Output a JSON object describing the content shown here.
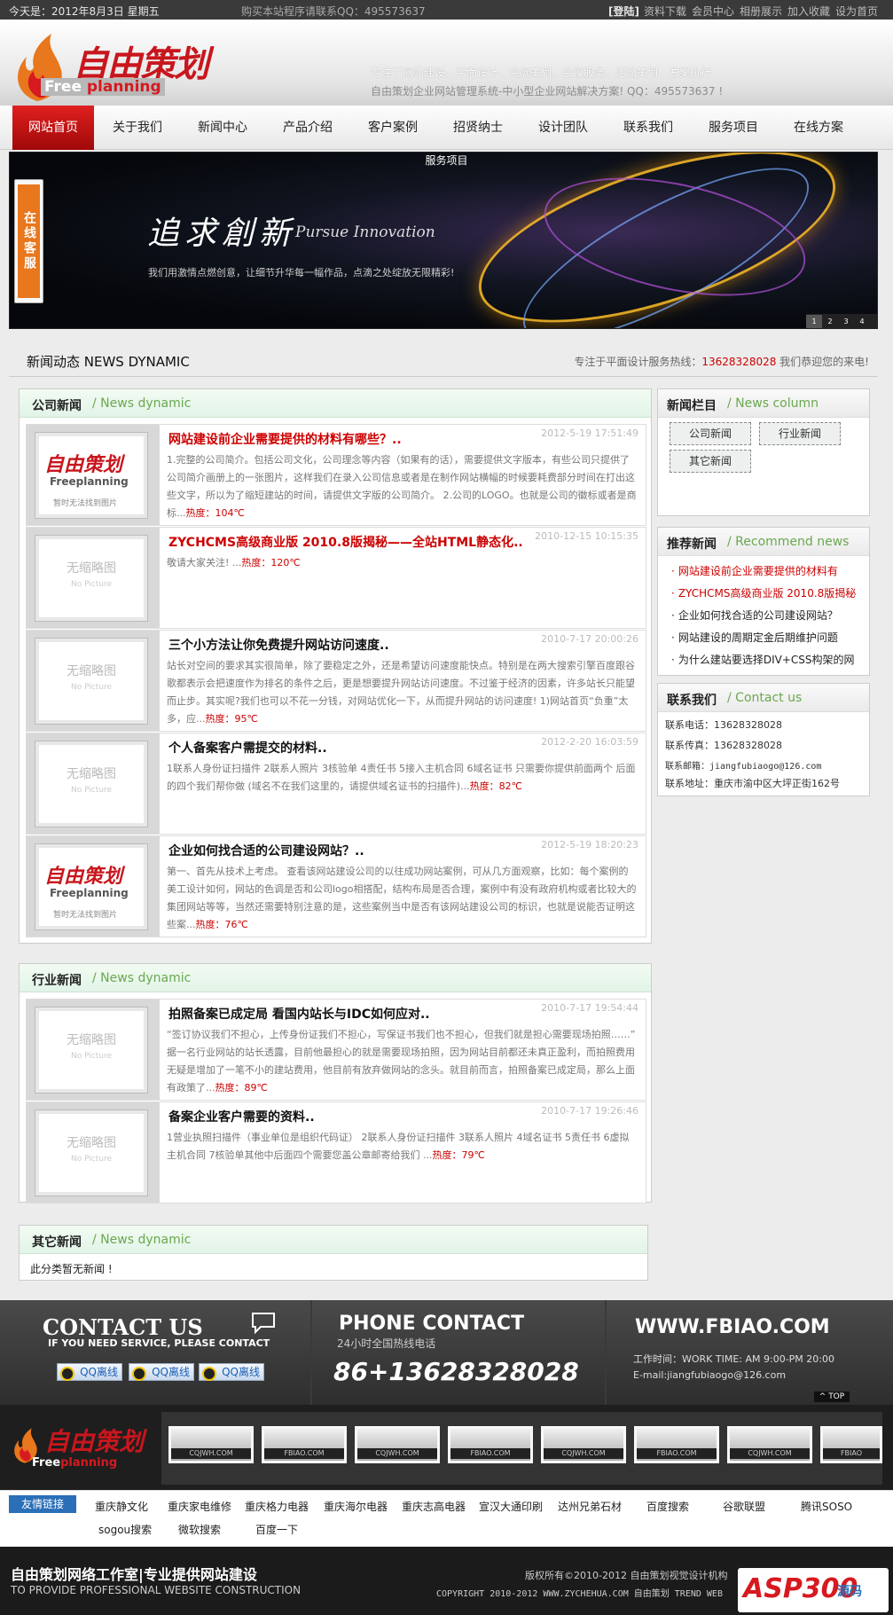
{
  "topbar": {
    "date": "今天是：2012年8月3日 星期五",
    "buy": "购买本站程序请联系QQ：495573637",
    "login": "[登陆]",
    "links": [
      "资料下载",
      "会员中心",
      "相册展示",
      "加入收藏",
      "设为首页"
    ]
  },
  "header": {
    "logo_cn": "自由策划",
    "logo_en_a": "Free",
    "logo_en_b": "planning",
    "slogan1": "专注于网站建设、平面设计、会展策划、会议服务、活动策划、方案执行",
    "slogan2": "自由策划企业网站管理系统-中小型企业网站解决方案! QQ：495573637 !"
  },
  "nav": [
    "网站首页",
    "关于我们",
    "新闻中心",
    "产品介绍",
    "客户案例",
    "招贤纳士",
    "设计团队",
    "联系我们",
    "服务项目",
    "在线方案"
  ],
  "banner": {
    "label": "服务项目",
    "title_cn": "追求創新",
    "title_en": "Pursue Innovation",
    "text": "我们用激情点燃创意，让细节升华每一幅作品，点滴之处绽放无限精彩!",
    "pages": [
      "1",
      "2",
      "3",
      "4"
    ],
    "online": "在线客服"
  },
  "section": {
    "title": "新闻动态  NEWS DYNAMIC",
    "hot_prefix": "专注于平面设计服务热线：",
    "hot_phone": "13628328028",
    "hot_suffix": " 我们恭迎您的来电!"
  },
  "company_news": {
    "cn": "公司新闻",
    "en": "/ News dynamic",
    "items": [
      {
        "title": "网站建设前企业需要提供的材料有哪些？..",
        "red": true,
        "date": "2012-5-19 17:51:49",
        "desc": "1.完整的公司简介。包括公司文化，公司理念等内容（如果有的话），需要提供文字版本，有些公司只提供了公司简介画册上的一张图片，这样我们在录入公司信息或者是在制作网站横幅的时候要耗费部分时间在打出这些文字，所以为了缩短建站的时间，请提供文字版的公司简介。 2.公司的LOGO。也就是公司的徽标或者是商标...",
        "heat": "热度：104℃",
        "thumb": "logo"
      },
      {
        "title": "ZYCHCMS高级商业版 2010.8版揭秘——全站HTML静态化..",
        "red": true,
        "date": "2010-12-15 10:15:35",
        "desc": "敬请大家关注! ...",
        "heat": "热度：120℃",
        "thumb": "none"
      },
      {
        "title": "三个小方法让你免费提升网站访问速度..",
        "red": false,
        "date": "2010-7-17 20:00:26",
        "desc": "站长对空间的要求其实很简单，除了要稳定之外，还是希望访问速度能快点。特别是在两大搜索引擎百度跟谷歌都表示会把速度作为排名的条件之后，更是想要提升网站访问速度。不过鉴于经济的因素，许多站长只能望而止步。其实呢?我们也可以不花一分钱，对网站优化一下，从而提升网站的访问速度! 1)网站首页“负重”太多，应...",
        "heat": "热度：95℃",
        "thumb": "none"
      },
      {
        "title": "个人备案客户需提交的材料..",
        "red": false,
        "date": "2012-2-20 16:03:59",
        "desc": "1联系人身份证扫描件 2联系人照片 3核验单 4责任书 5接入主机合同 6域名证书 只需要你提供前面两个 后面的四个我们帮你做 (域名不在我们这里的，请提供域名证书的扫描件)...",
        "heat": "热度：82℃",
        "thumb": "none"
      },
      {
        "title": "企业如何找合适的公司建设网站？..",
        "red": false,
        "date": "2012-5-19 18:20:23",
        "desc": "第一、首先从技术上考虑。 查看该网站建设公司的以往成功网站案例，可从几方面观察，比如：每个案例的美工设计如何，网站的色调是否和公司logo相搭配，结构布局是否合理，案例中有没有政府机构或者比较大的集团网站等等，当然还需要特别注意的是，这些案例当中是否有该网站建设公司的标识，也就是说能否证明这些案...",
        "heat": "热度：76℃",
        "thumb": "logo"
      }
    ]
  },
  "industry_news": {
    "cn": "行业新闻",
    "en": "/ News dynamic",
    "items": [
      {
        "title": "拍照备案已成定局 看国内站长与IDC如何应对..",
        "red": false,
        "date": "2010-7-17 19:54:44",
        "desc": "“签订协议我们不担心，上传身份证我们不担心，写保证书我们也不担心，但我们就是担心需要现场拍照……” 据一名行业网站的站长透露，目前他最担心的就是需要现场拍照，因为网站目前都还未真正盈利，而拍照费用无疑是增加了一笔不小的建站费用，他目前有放弃做网站的念头。就目前而言，拍照备案已成定局，那么上面有政策了...",
        "heat": "热度：89℃",
        "thumb": "none"
      },
      {
        "title": "备案企业客户需要的资料..",
        "red": false,
        "date": "2010-7-17 19:26:46",
        "desc": "1营业执照扫描件（事业单位是组织代码证） 2联系人身份证扫描件 3联系人照片 4域名证书 5责任书 6虚拟主机合同 7核验单其他中后面四个需要您盖公章邮寄给我们 ...",
        "heat": "热度：79℃",
        "thumb": "none"
      }
    ]
  },
  "other_news": {
    "cn": "其它新闻",
    "en": "/ News dynamic",
    "empty": "此分类暂无新闻 !"
  },
  "thumb": {
    "np1": "无缩略图",
    "np2": "No Picture",
    "logo_cn": "自由策划",
    "logo_en": "Freeplanning",
    "logo_sub": "暂时无法找到图片"
  },
  "news_column": {
    "cn": "新闻栏目",
    "en": "/ News column",
    "cats": [
      "公司新闻",
      "行业新闻",
      "其它新闻"
    ]
  },
  "recommend": {
    "cn": "推荐新闻",
    "en": "/ Recommend news",
    "items": [
      {
        "t": "网站建设前企业需要提供的材料有",
        "red": true
      },
      {
        "t": "ZYCHCMS高级商业版 2010.8版揭秘",
        "red": true
      },
      {
        "t": "企业如何找合适的公司建设网站？",
        "red": false
      },
      {
        "t": "网站建设的周期定金后期维护问题",
        "red": false
      },
      {
        "t": "为什么建站要选择DIV+CSS构架的网",
        "red": false
      }
    ]
  },
  "contact": {
    "cn": "联系我们",
    "en": "/ Contact us",
    "lines": [
      "联系电话：13628328028",
      "联系传真：13628328028",
      "联系邮箱：jiangfubiaogo@126.com",
      "联系地址：重庆市渝中区大坪正街162号"
    ]
  },
  "footer": {
    "contact_us": "CONTACT US",
    "contact_sub": "IF YOU NEED SERVICE, PLEASE CONTACT",
    "qq": [
      "QQ离线",
      "QQ离线",
      "QQ离线"
    ],
    "phone_title": "PHONE CONTACT",
    "phone_sub": "24小时全国热线电话",
    "phone": "86+13628328028",
    "web": "WWW.FBIAO.COM",
    "worktime": "工作时间：WORK TIME: AM 9:00-PM 20:00",
    "email": "E-mail:jiangfubiaogo@126.com",
    "totop": "TOP",
    "ads": [
      "CQJWH.COM",
      "FBIAO.COM",
      "CQJWH.COM",
      "FBIAO.COM",
      "CQJWH.COM",
      "FBIAO.COM",
      "CQJWH.COM",
      "FBIAO"
    ],
    "links_label": "友情链接",
    "links": [
      "重庆静文化",
      "重庆家电维修",
      "重庆格力电器",
      "重庆海尔电器",
      "重庆志高电器",
      "宣汉大通印刷",
      "达州兄弟石材",
      "百度搜索",
      "谷歌联盟",
      "腾讯SOSO",
      "sogou搜索",
      "微软搜索",
      "百度一下"
    ],
    "studio": "自由策划网络工作室|专业提供网站建设",
    "studio_en": "TO PROVIDE PROFESSIONAL WEBSITE CONSTRUCTION",
    "copyright": "版权所有©2010-2012  自由策划视觉设计机构",
    "copyright2": "COPYRIGHT 2010-2012 WWW.ZYCHEHUA.COM 自由策划 TREND WEB",
    "asp": "ASP300",
    "asp2": "源码"
  },
  "colors": {
    "accent": "#c8161d",
    "green": "#6aa84f",
    "dark": "#3a3a3a"
  }
}
